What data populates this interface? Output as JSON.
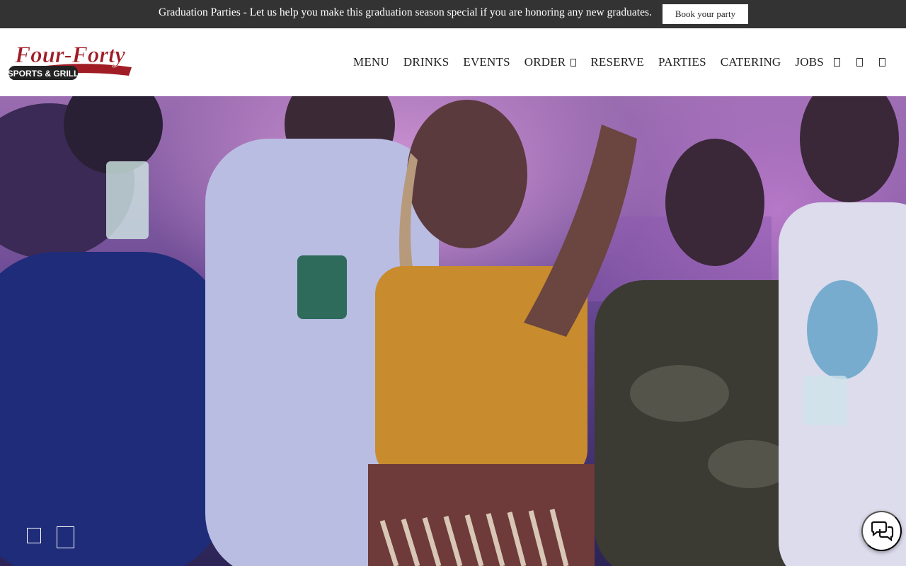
{
  "announcement": {
    "text": "Graduation Parties - Let us help you make this graduation season special if you are honoring any new graduates.",
    "button_label": "Book your party"
  },
  "logo": {
    "line1": "Four-Forty",
    "line2": "SPORTS & GRILL",
    "brand_color": "#a01d26"
  },
  "nav": {
    "items": [
      {
        "label": "MENU"
      },
      {
        "label": "DRINKS"
      },
      {
        "label": "EVENTS"
      },
      {
        "label": "ORDER",
        "has_dropdown": true
      },
      {
        "label": "RESERVE"
      },
      {
        "label": "PARTIES"
      },
      {
        "label": "CATERING"
      },
      {
        "label": "JOBS"
      }
    ],
    "icons": [
      "facebook-icon",
      "instagram-icon",
      "twitter-icon"
    ]
  },
  "hero": {
    "media": "party-video",
    "controls": [
      "pause-icon",
      "volume-icon"
    ]
  },
  "chat": {
    "icon": "chat-bubbles-icon"
  },
  "colors": {
    "announce_bg": "#333333",
    "header_bg": "#ffffff",
    "nav_text": "#1e1e1e"
  }
}
